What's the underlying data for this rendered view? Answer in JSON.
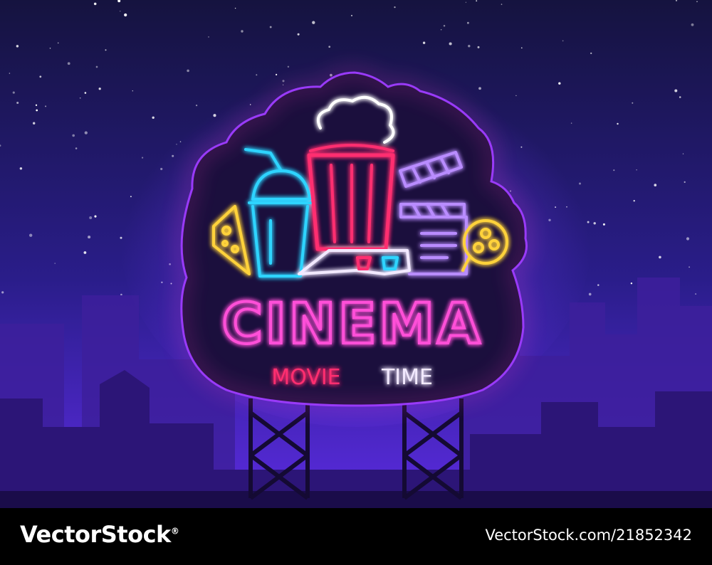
{
  "sign": {
    "title": "CINEMA",
    "subtitle_word1": "MOVIE",
    "subtitle_word2": "TIME"
  },
  "footer": {
    "brand": "VectorStock",
    "brand_mark": "®",
    "image_id": "VectorStock.com/21852342"
  },
  "colors": {
    "sky_top": "#1a1650",
    "sky_bottom": "#5a2ad8",
    "neon_pink": "#ff4fd8",
    "neon_red": "#ff2d6f",
    "neon_blue": "#2fd4ff",
    "neon_yellow": "#ffd23a",
    "neon_violet": "#b98cff",
    "neon_white": "#f2e9ff"
  }
}
